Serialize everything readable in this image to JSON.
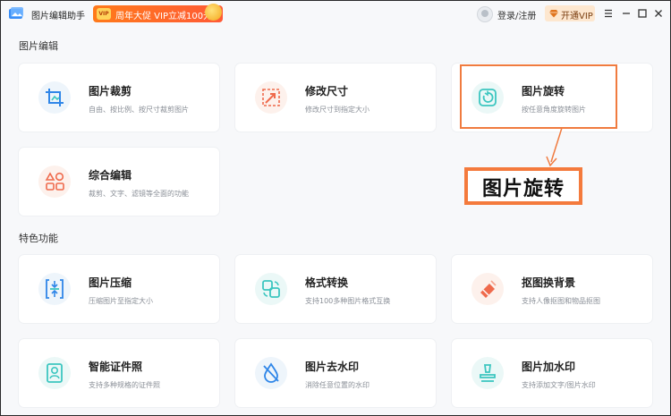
{
  "app": {
    "title": "图片编辑助手"
  },
  "promo": {
    "badge": "VIP",
    "text": "周年大促 VIP立减100元"
  },
  "header": {
    "login": "登录/注册",
    "vip_button": "开通VIP"
  },
  "sections": {
    "edit": {
      "title": "图片编辑",
      "cards": [
        {
          "title": "图片裁剪",
          "desc": "自由、按比例、按尺寸裁剪图片",
          "icon": "crop-icon"
        },
        {
          "title": "修改尺寸",
          "desc": "修改尺寸到指定大小",
          "icon": "resize-icon"
        },
        {
          "title": "图片旋转",
          "desc": "按任意角度旋转图片",
          "icon": "rotate-icon"
        },
        {
          "title": "综合编辑",
          "desc": "裁剪、文字、滤镜等全面的功能",
          "icon": "grid-shapes-icon"
        }
      ]
    },
    "features": {
      "title": "特色功能",
      "cards": [
        {
          "title": "图片压缩",
          "desc": "压缩图片至指定大小",
          "icon": "compress-icon"
        },
        {
          "title": "格式转换",
          "desc": "支持100多种图片格式互换",
          "icon": "convert-icon"
        },
        {
          "title": "抠图换背景",
          "desc": "支持人像抠图和物品抠图",
          "icon": "eraser-icon"
        },
        {
          "title": "智能证件照",
          "desc": "支持多种规格的证件照",
          "icon": "id-photo-icon"
        },
        {
          "title": "图片去水印",
          "desc": "消除任意位置的水印",
          "icon": "remove-watermark-icon"
        },
        {
          "title": "图片加水印",
          "desc": "支持添加文字/图片水印",
          "icon": "add-watermark-icon"
        }
      ]
    }
  },
  "callout": {
    "text": "图片旋转"
  },
  "colors": {
    "accent": "#f47a3c",
    "teal": "#3cc6c0",
    "icon_bg": "#eef5fb"
  }
}
